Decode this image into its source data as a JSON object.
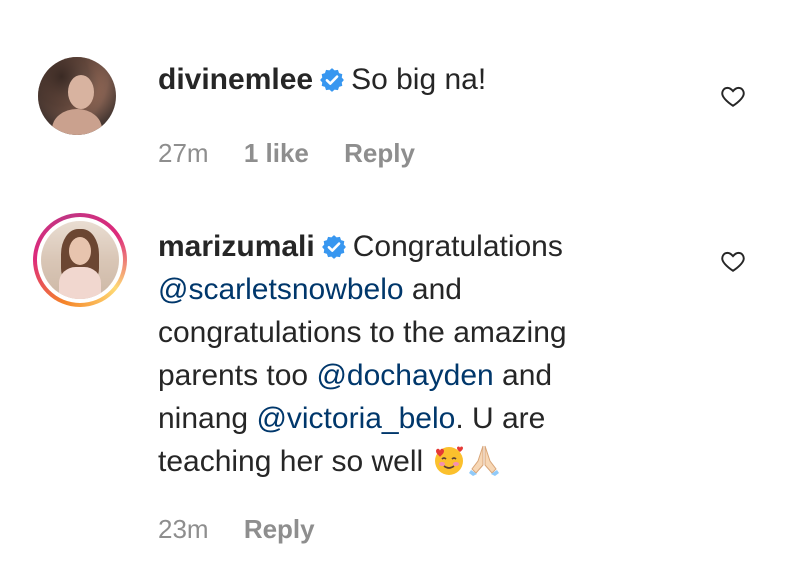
{
  "comments": [
    {
      "username": "divinemlee",
      "verified": true,
      "text": "So big na!",
      "time": "27m",
      "likes": "1 like",
      "reply": "Reply"
    },
    {
      "username": "marizumali",
      "verified": true,
      "text_parts": {
        "p1": "Congratulations",
        "m1": "@scarletsnowbelo",
        "p2": " and",
        "p3": "congratulations to the amazing",
        "p4": "parents too ",
        "m2": "@dochayden",
        "p5": " and",
        "p6": "ninang ",
        "m3": "@victoria_belo",
        "p7": ". U are",
        "p8": "teaching her so well "
      },
      "emoji": [
        "smiling-face-with-hearts",
        "folded-hands"
      ],
      "time": "23m",
      "reply": "Reply"
    }
  ],
  "colors": {
    "text": "#262626",
    "meta": "#8e8e8e",
    "mention": "#00376b",
    "verified": "#3897f0"
  }
}
